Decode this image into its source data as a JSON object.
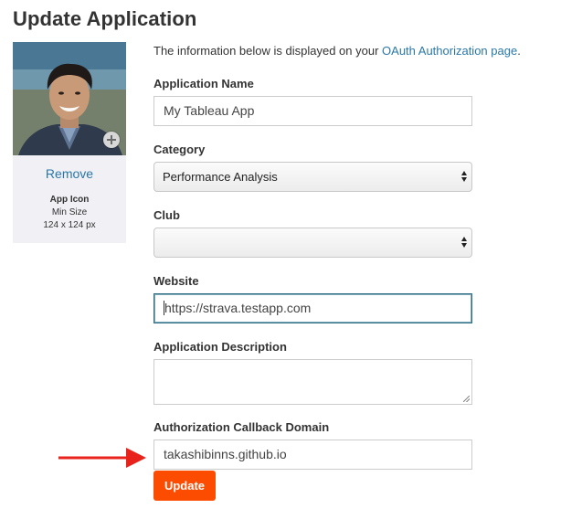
{
  "page": {
    "title": "Update Application"
  },
  "icon_panel": {
    "remove_label": "Remove",
    "caption_title": "App Icon",
    "caption_line1": "Min Size",
    "caption_line2": "124 x 124 px"
  },
  "intro": {
    "text": "The information below is displayed on your ",
    "link_text": "OAuth Authorization page",
    "suffix": "."
  },
  "form": {
    "app_name": {
      "label": "Application Name",
      "value": "My Tableau App"
    },
    "category": {
      "label": "Category",
      "selected": "Performance Analysis"
    },
    "club": {
      "label": "Club",
      "selected": ""
    },
    "website": {
      "label": "Website",
      "value": "https://strava.testapp.com"
    },
    "description": {
      "label": "Application Description",
      "value": ""
    },
    "callback_domain": {
      "label": "Authorization Callback Domain",
      "value": "takashibinns.github.io"
    },
    "submit_label": "Update"
  },
  "colors": {
    "accent": "#fc4c02",
    "link": "#2a78a8",
    "annotation_arrow": "#e8231c"
  },
  "icons": {
    "add": "plus-circle-icon",
    "select": "chevron-up-down-icon",
    "annotation": "red-arrow-icon"
  }
}
